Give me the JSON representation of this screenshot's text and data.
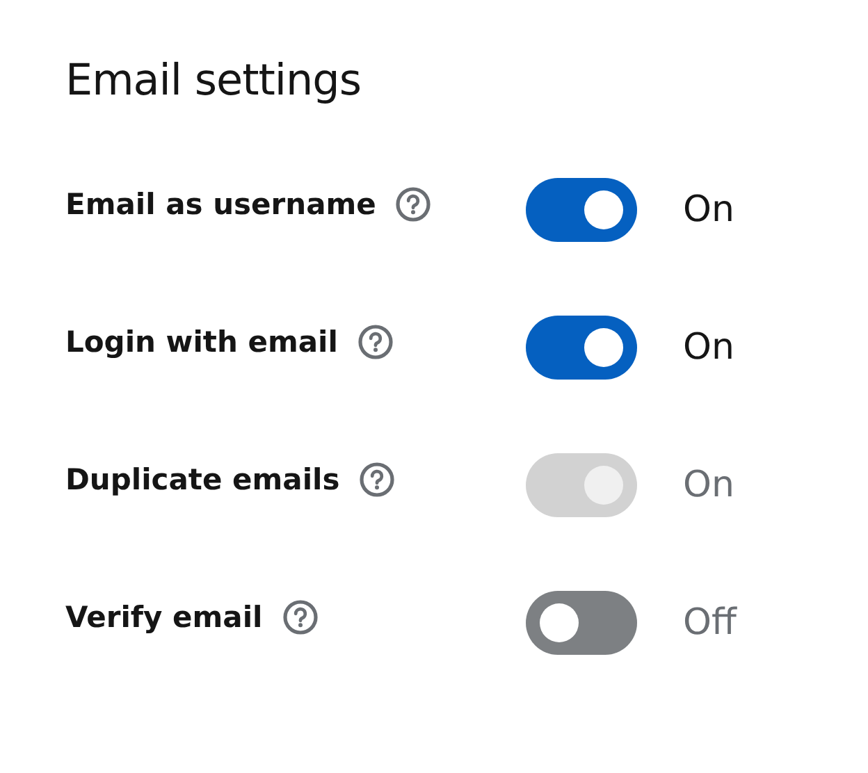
{
  "title": "Email settings",
  "settings": [
    {
      "label": "Email as username",
      "on": true,
      "disabled": false,
      "status": "On"
    },
    {
      "label": "Login with email",
      "on": true,
      "disabled": false,
      "status": "On"
    },
    {
      "label": "Duplicate emails",
      "on": true,
      "disabled": true,
      "status": "On"
    },
    {
      "label": "Verify email",
      "on": false,
      "disabled": false,
      "status": "Off"
    }
  ]
}
